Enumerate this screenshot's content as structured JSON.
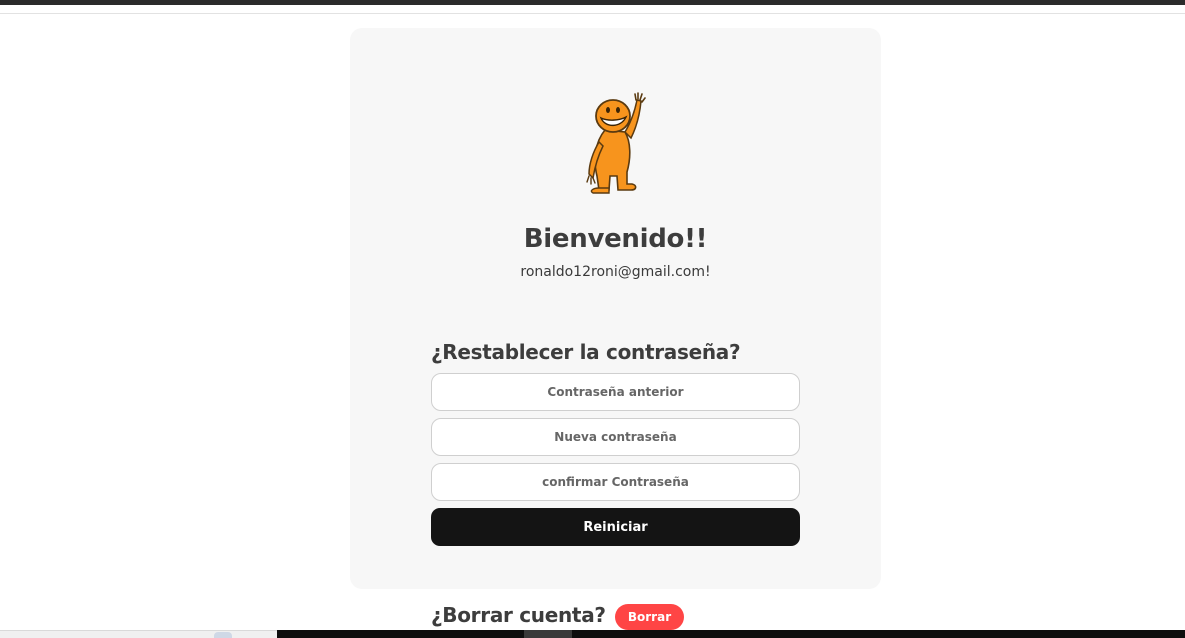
{
  "colors": {
    "card_background": "#f7f7f7",
    "primary_button": "#141414",
    "danger_button": "#ff4545",
    "mascot": "#f7941d"
  },
  "profile": {
    "mascot_icon": "waving-person-icon",
    "greeting": "Bienvenido!!",
    "email": "ronaldo12roni@gmail.com!"
  },
  "reset_password": {
    "title": "¿Restablecer la contraseña?",
    "old_password_placeholder": "Contraseña anterior",
    "new_password_placeholder": "Nueva contraseña",
    "confirm_password_placeholder": "confirmar Contraseña",
    "submit_label": "Reiniciar"
  },
  "delete_account": {
    "title": "¿Borrar cuenta?",
    "button_label": "Borrar"
  }
}
